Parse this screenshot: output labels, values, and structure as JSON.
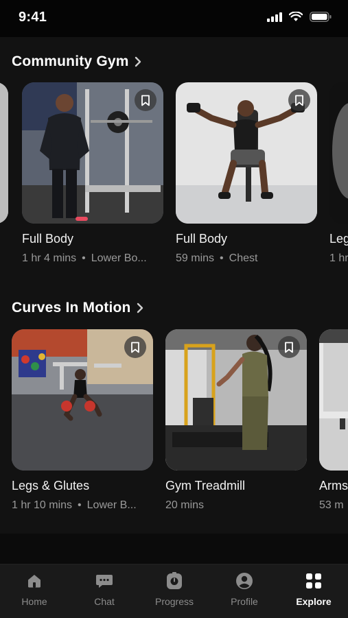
{
  "status_bar": {
    "time": "9:41",
    "icons": [
      "signal-icon",
      "wifi-icon",
      "battery-icon"
    ]
  },
  "sections": [
    {
      "title": "Community Gym",
      "cards": [
        {
          "title": "",
          "meta_duration": "",
          "meta_tag": "",
          "partial": "left"
        },
        {
          "title": "Full Body",
          "meta_duration": "1 hr 4 mins",
          "meta_tag": "Lower Bo..."
        },
        {
          "title": "Full Body",
          "meta_duration": "59 mins",
          "meta_tag": "Chest"
        },
        {
          "title": "Leg",
          "meta_duration": "1 hr",
          "meta_tag": "",
          "partial": "right"
        }
      ]
    },
    {
      "title": "Curves In Motion",
      "cards": [
        {
          "title": "Legs & Glutes",
          "meta_duration": "1 hr 10 mins",
          "meta_tag": "Lower B..."
        },
        {
          "title": "Gym Treadmill",
          "meta_duration": "20 mins",
          "meta_tag": ""
        },
        {
          "title": "Arms",
          "meta_duration": "53 m",
          "meta_tag": "",
          "partial": "right"
        }
      ]
    }
  ],
  "tab_bar": {
    "tabs": [
      {
        "label": "Home",
        "icon": "home-icon"
      },
      {
        "label": "Chat",
        "icon": "chat-icon"
      },
      {
        "label": "Progress",
        "icon": "progress-icon"
      },
      {
        "label": "Profile",
        "icon": "profile-icon"
      },
      {
        "label": "Explore",
        "icon": "grid-icon",
        "active": true
      }
    ]
  },
  "colors": {
    "background": "#121212",
    "tab_bar": "#1a1a1a",
    "muted_text": "#9a9a9a",
    "active_tab": "#ffffff"
  }
}
